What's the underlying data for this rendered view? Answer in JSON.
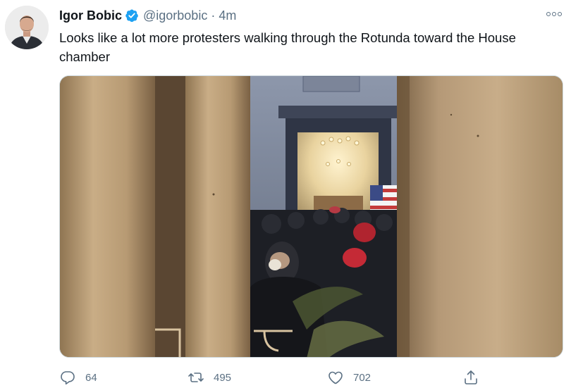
{
  "tweet": {
    "author": {
      "display_name": "Igor Bobic",
      "handle": "@igorbobic",
      "verified": true,
      "avatar_icon": "profile-photo"
    },
    "separator": "·",
    "timestamp": "4m",
    "text": "Looks like a lot more protesters walking through the Rotunda toward the House chamber",
    "more_icon": "more-options-icon",
    "media": {
      "type": "photo"
    },
    "actions": {
      "reply": {
        "icon": "reply-icon",
        "count": "64"
      },
      "retweet": {
        "icon": "retweet-icon",
        "count": "495"
      },
      "like": {
        "icon": "heart-icon",
        "count": "702"
      },
      "share": {
        "icon": "share-icon"
      }
    },
    "colors": {
      "text": "#0f1419",
      "secondary": "#5b7083",
      "verified": "#1da1f2"
    }
  }
}
